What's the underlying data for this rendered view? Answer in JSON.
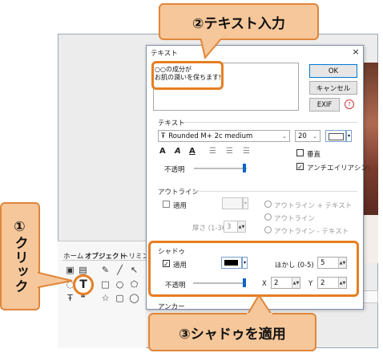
{
  "callouts": {
    "step1": "①クリック",
    "step2": "②テキスト入力",
    "step3": "③シャドゥを適用"
  },
  "toolpanel": {
    "tabs": [
      "ホーム",
      "オブジェクト",
      "トリミング"
    ],
    "text_tool_glyph": "T"
  },
  "dialog": {
    "title": "テキスト",
    "close_glyph": "×",
    "text_lines": [
      "○○の成分が",
      "お肌の潤いを保ちます!"
    ],
    "ok_label": "OK",
    "cancel_label": "キャンセル",
    "exif_label": "EXIF",
    "text_section": {
      "heading": "テキスト",
      "font_name": "Rounded M+ 2c medium",
      "font_size": "20",
      "vertical_label": "垂直",
      "antialias_label": "アンチエイリアシン:",
      "opacity_label": "不透明"
    },
    "outline_section": {
      "heading": "アウトライン",
      "apply_label": "適用",
      "thickness_label": "厚さ (1-36)",
      "thickness_value": "3",
      "radio_outline_text": "アウトライン + テキスト",
      "radio_outline": "アウトライン",
      "radio_outline_minus_text": "アウトライン - テキスト"
    },
    "shadow_section": {
      "heading": "シャドゥ",
      "apply_label": "適用",
      "blur_label": "ほかし (0-5)",
      "blur_value": "5",
      "opacity_label": "不透明",
      "x_label": "X",
      "x_value": "2",
      "y_label": "Y",
      "y_value": "2"
    },
    "anchor_heading": "アンカー"
  },
  "colors": {
    "callout_fill": "#f5c79a",
    "callout_border": "#e0873a",
    "highlight": "#e67e22",
    "slider_thumb": "#0a64c8"
  }
}
